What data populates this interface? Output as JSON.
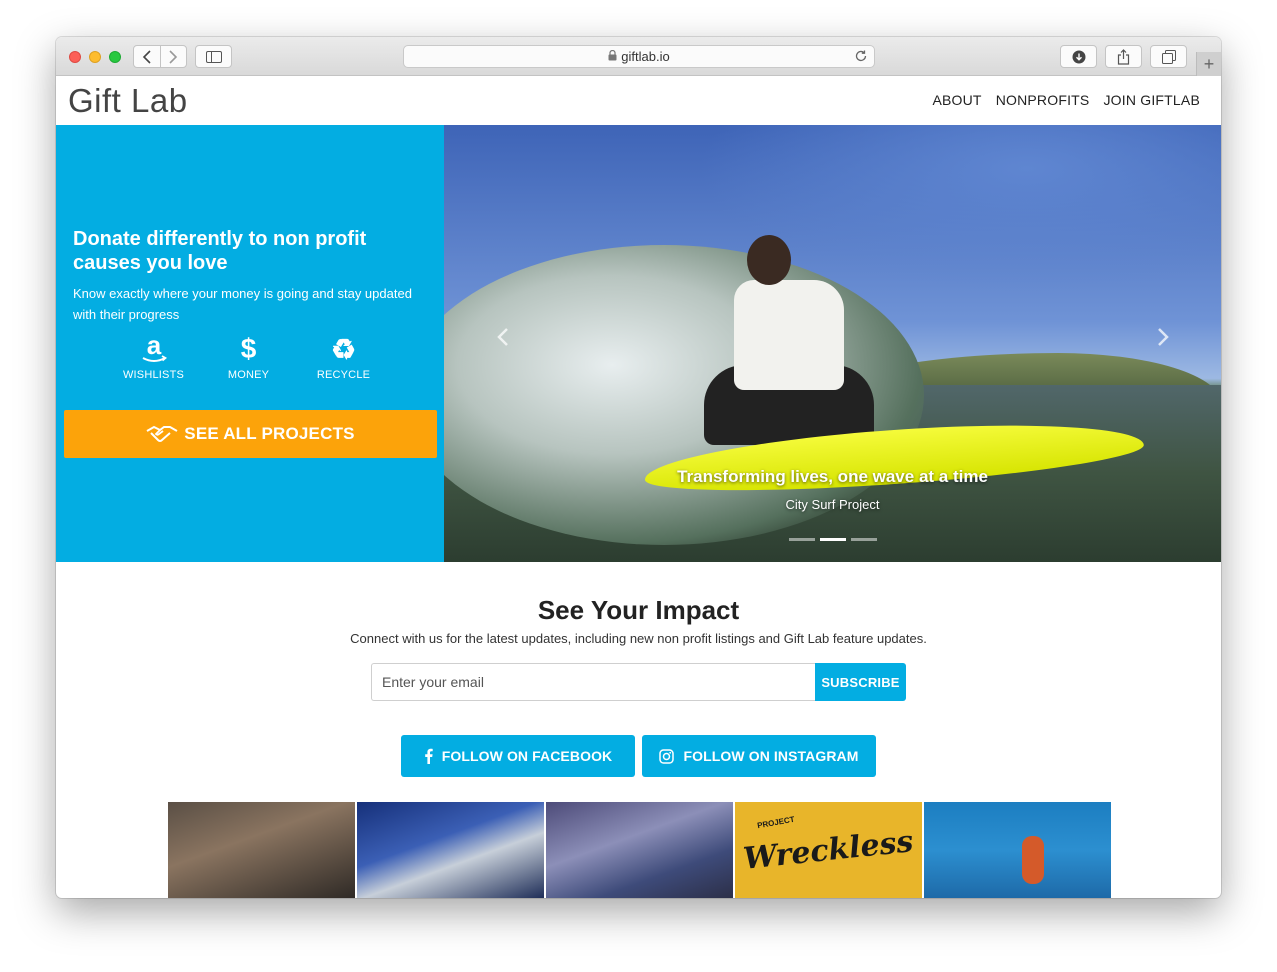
{
  "browser": {
    "url": "giftlab.io"
  },
  "site": {
    "logo": "Gift Lab",
    "nav": [
      "ABOUT",
      "NONPROFITS",
      "JOIN GIFTLAB"
    ]
  },
  "hero": {
    "title": "Donate differently to non profit causes you love",
    "subtitle": "Know exactly where your money is going and stay updated with their progress",
    "options": [
      {
        "label": "WISHLISTS",
        "icon": "amazon-icon"
      },
      {
        "label": "MONEY",
        "icon": "dollar-icon"
      },
      {
        "label": "RECYCLE",
        "icon": "recycle-icon"
      }
    ],
    "cta": "SEE ALL PROJECTS",
    "accent": "#03ade2",
    "cta_color": "#fca30a"
  },
  "carousel": {
    "caption_title": "Transforming lives, one wave at a time",
    "caption_sub": "City Surf Project",
    "slide_count": 3,
    "active_index": 1
  },
  "impact": {
    "title": "See Your Impact",
    "subtitle": "Connect with us for the latest updates, including new non profit listings and Gift Lab feature updates.",
    "email_placeholder": "Enter your email",
    "subscribe": "SUBSCRIBE",
    "facebook": "FOLLOW ON FACEBOOK",
    "instagram": "FOLLOW ON INSTAGRAM"
  },
  "gallery": {
    "wreckless_top": "PROJECT",
    "wreckless_main": "Wreckless"
  }
}
